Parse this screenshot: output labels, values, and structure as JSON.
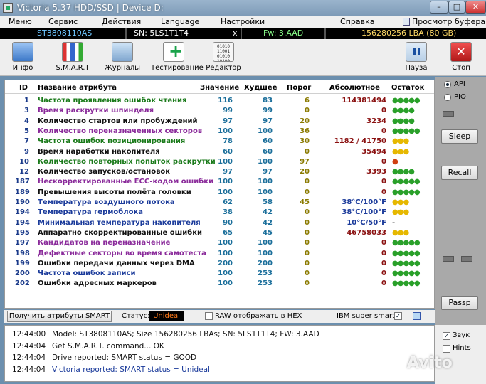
{
  "window": {
    "title": "Victoria 5.37 HDD/SSD | Device D:"
  },
  "menu": [
    "Меню",
    "Сервис",
    "Действия",
    "Language",
    "Настройки",
    "Справка",
    "Просмотр буфера"
  ],
  "device": {
    "model": "ST3808110AS",
    "serial": "SN: 5LS1T1T4",
    "x": "x",
    "firmware": "Fw: 3.AAD",
    "lba": "156280256 LBA (80 GB)"
  },
  "toolbar": {
    "info": "Инфо",
    "smart": "S.M.A.R.T",
    "logs": "Журналы",
    "test": "Тестирование",
    "editor": "Редактор",
    "pause": "Пауза",
    "stop": "Стоп",
    "editor_icon_lines": [
      "01010",
      "11001",
      "01010",
      "10100"
    ]
  },
  "table": {
    "headers": {
      "id": "ID",
      "name": "Название атрибута",
      "value": "Значение",
      "worst": "Худшее",
      "threshold": "Порог",
      "raw": "Абсолютное",
      "remaining": "Остаток"
    },
    "rows": [
      {
        "id": "1",
        "name": "Частота проявления ошибок чтения",
        "value": "116",
        "worst": "83",
        "threshold": "6",
        "raw": "114381494",
        "remaining": "●●●●●",
        "name_color": "#1a7a1a",
        "rem_color": "#2aa02a"
      },
      {
        "id": "3",
        "name": "Время раскрутки шпинделя",
        "value": "99",
        "worst": "99",
        "threshold": "0",
        "raw": "0",
        "remaining": "●●●●",
        "name_color": "#8a2a9a",
        "rem_color": "#2aa02a"
      },
      {
        "id": "4",
        "name": "Количество стартов или пробуждений",
        "value": "97",
        "worst": "97",
        "threshold": "20",
        "raw": "3234",
        "remaining": "●●●●",
        "name_color": "#111111",
        "rem_color": "#2aa02a"
      },
      {
        "id": "5",
        "name": "Количество переназначенных секторов",
        "value": "100",
        "worst": "100",
        "threshold": "36",
        "raw": "0",
        "remaining": "●●●●●",
        "name_color": "#8a2a9a",
        "rem_color": "#2aa02a"
      },
      {
        "id": "7",
        "name": "Частота ошибок позиционирования",
        "value": "78",
        "worst": "60",
        "threshold": "30",
        "raw": "1182 / 41750",
        "remaining": "●●●",
        "name_color": "#1a7a1a",
        "rem_color": "#e6b800"
      },
      {
        "id": "9",
        "name": "Время наработки накопителя",
        "value": "60",
        "worst": "60",
        "threshold": "0",
        "raw": "35494",
        "remaining": "●●●",
        "name_color": "#111111",
        "rem_color": "#e6b800"
      },
      {
        "id": "10",
        "name": "Количество повторных попыток раскрутки",
        "value": "100",
        "worst": "100",
        "threshold": "97",
        "raw": "0",
        "remaining": "●",
        "name_color": "#1a7a1a",
        "rem_color": "#d04010"
      },
      {
        "id": "12",
        "name": "Количество запусков/остановок",
        "value": "97",
        "worst": "97",
        "threshold": "20",
        "raw": "3393",
        "remaining": "●●●●",
        "name_color": "#111111",
        "rem_color": "#2aa02a"
      },
      {
        "id": "187",
        "name": "Нескорректированные ECC-кодом ошибки",
        "value": "100",
        "worst": "100",
        "threshold": "0",
        "raw": "0",
        "remaining": "●●●●●",
        "name_color": "#8a2a9a",
        "rem_color": "#2aa02a"
      },
      {
        "id": "189",
        "name": "Превышения высоты полёта головки",
        "value": "100",
        "worst": "100",
        "threshold": "0",
        "raw": "0",
        "remaining": "●●●●●",
        "name_color": "#111111",
        "rem_color": "#2aa02a"
      },
      {
        "id": "190",
        "name": "Температура воздушного потока",
        "value": "62",
        "worst": "58",
        "threshold": "45",
        "raw": "38°C/100°F",
        "remaining": "●●●",
        "name_color": "#1a3a9a",
        "rem_color": "#e6b800",
        "raw_color": "#1a3a9a"
      },
      {
        "id": "194",
        "name": "Температура гермоблока",
        "value": "38",
        "worst": "42",
        "threshold": "0",
        "raw": "38°C/100°F",
        "remaining": "●●●",
        "name_color": "#1a3a9a",
        "rem_color": "#e6b800",
        "raw_color": "#1a3a9a"
      },
      {
        "id": "194",
        "name": "Минимальная температура накопителя",
        "value": "90",
        "worst": "42",
        "threshold": "0",
        "raw": "10°C/50°F",
        "remaining": "-",
        "name_color": "#1a3a9a",
        "rem_color": "#333333",
        "raw_color": "#1a3a9a"
      },
      {
        "id": "195",
        "name": "Аппаратно скорректированные ошибки",
        "value": "65",
        "worst": "45",
        "threshold": "0",
        "raw": "46758033",
        "remaining": "●●●",
        "name_color": "#111111",
        "rem_color": "#e6b800"
      },
      {
        "id": "197",
        "name": "Кандидатов на переназначение",
        "value": "100",
        "worst": "100",
        "threshold": "0",
        "raw": "0",
        "remaining": "●●●●●",
        "name_color": "#8a2a9a",
        "rem_color": "#2aa02a"
      },
      {
        "id": "198",
        "name": "Дефектные секторы во время самотеста",
        "value": "100",
        "worst": "100",
        "threshold": "0",
        "raw": "0",
        "remaining": "●●●●●",
        "name_color": "#8a2a9a",
        "rem_color": "#2aa02a"
      },
      {
        "id": "199",
        "name": "Ошибки передачи данных через DMA",
        "value": "200",
        "worst": "200",
        "threshold": "0",
        "raw": "0",
        "remaining": "●●●●●",
        "name_color": "#111111",
        "rem_color": "#2aa02a"
      },
      {
        "id": "200",
        "name": "Частота ошибок записи",
        "value": "100",
        "worst": "253",
        "threshold": "0",
        "raw": "0",
        "remaining": "●●●●●",
        "name_color": "#1a3a9a",
        "rem_color": "#2aa02a"
      },
      {
        "id": "202",
        "name": "Ошибки адресных маркеров",
        "value": "100",
        "worst": "253",
        "threshold": "0",
        "raw": "0",
        "remaining": "●●●●●",
        "name_color": "#111111",
        "rem_color": "#2aa02a"
      }
    ]
  },
  "status_bar": {
    "get_button": "Получить атрибуты SMART",
    "status_label": "Статус:",
    "status_value": "Unideal",
    "raw_hex_label": "RAW отображать в HEX",
    "raw_hex_checked": false,
    "ibm_label": "IBM super smart:",
    "ibm_checked": true,
    "check_mark": "✓"
  },
  "log": [
    {
      "time": "12:44:00",
      "msg": "Model: ST3808110AS; Size 156280256 LBAs; SN: 5LS1T1T4; FW: 3.AAD",
      "color": "#111111"
    },
    {
      "time": "12:44:04",
      "msg": "Get S.M.A.R.T. command... OK",
      "color": "#111111"
    },
    {
      "time": "12:44:04",
      "msg": "Drive reported: SMART status = GOOD",
      "color": "#111111"
    },
    {
      "time": "12:44:04",
      "msg": "Victoria reported: SMART status = Unideal",
      "color": "#1a3a9a"
    }
  ],
  "side": {
    "api": "API",
    "pio": "PIO",
    "api_selected": true,
    "sleep": "Sleep",
    "recall": "Recall",
    "passp": "Passp",
    "sound": "Звук",
    "sound_checked": true,
    "hints": "Hints",
    "hints_checked": false
  },
  "watermark": "Avito"
}
